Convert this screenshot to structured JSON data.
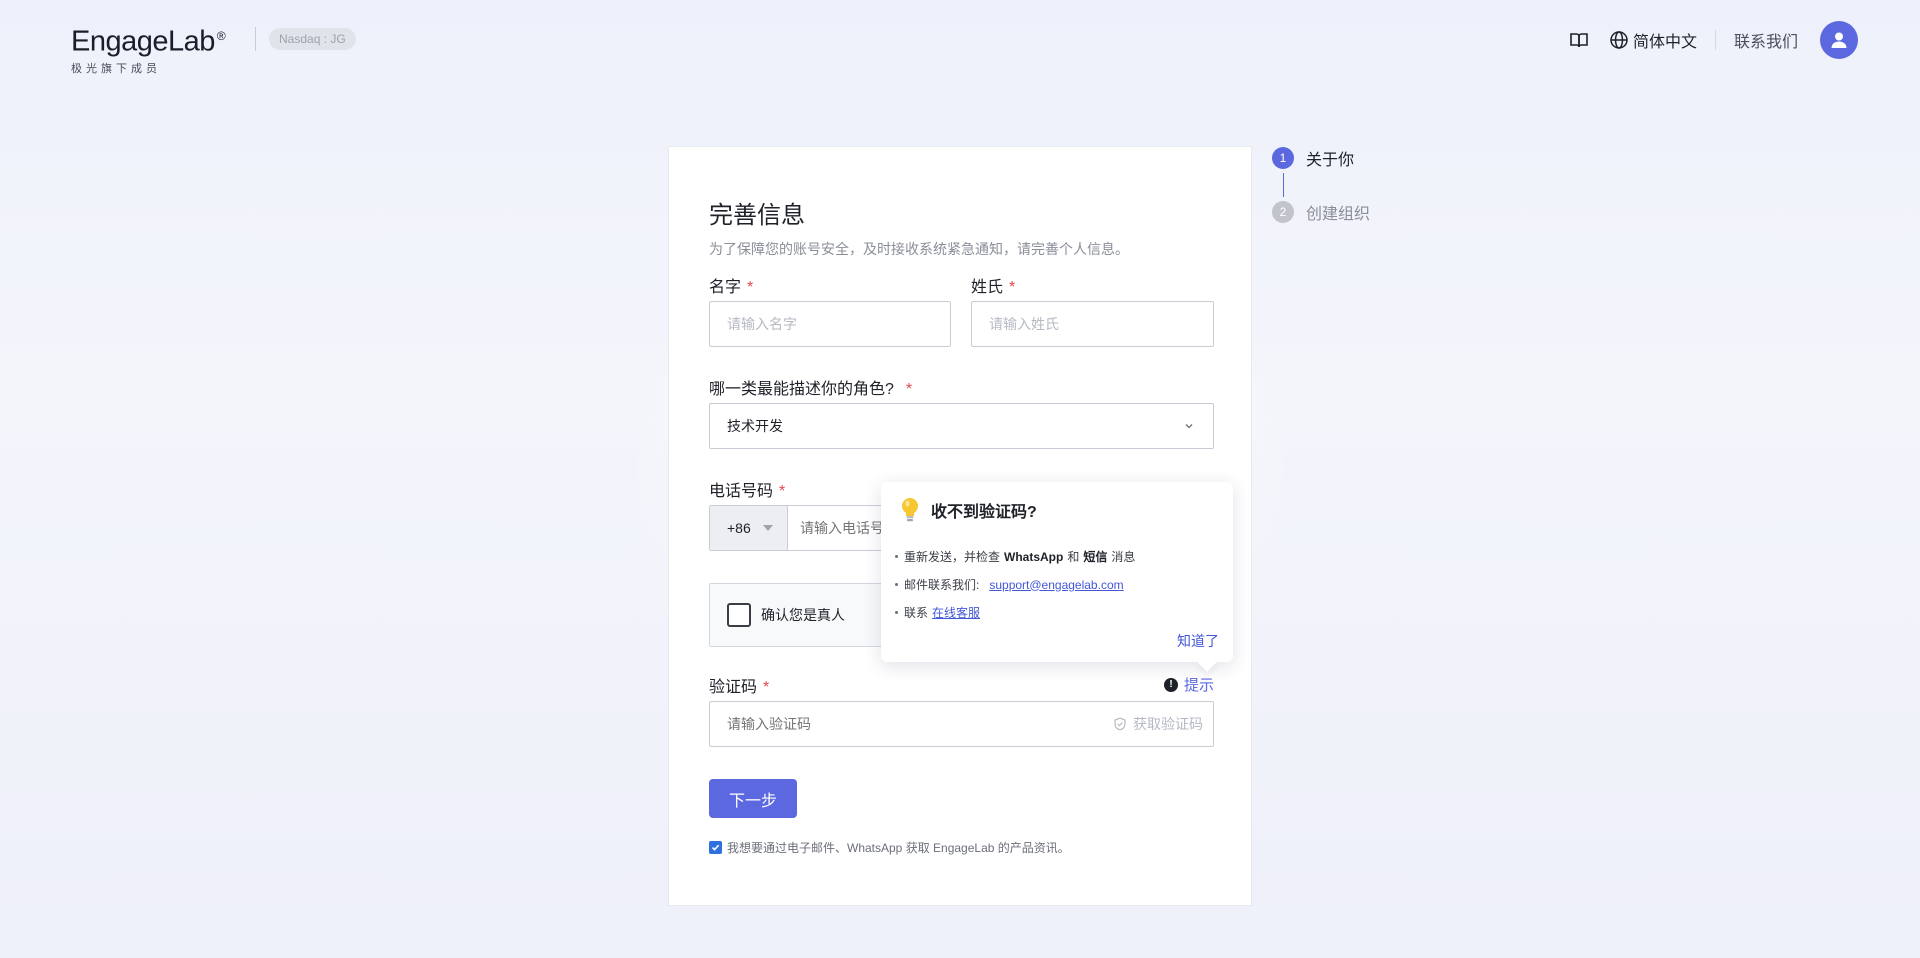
{
  "header": {
    "logo_text": "EngageLab",
    "logo_reg": "®",
    "logo_subtitle": "极光旗下成员",
    "nasdaq_badge": "Nasdaq : JG",
    "language": "简体中文",
    "contact_us": "联系我们",
    "icons": {
      "docs": "book-icon",
      "language": "globe-icon",
      "avatar": "user-icon"
    }
  },
  "form": {
    "title": "完善信息",
    "subtitle": "为了保障您的账号安全，及时接收系统紧急通知，请完善个人信息。",
    "required_mark": "*",
    "first_name": {
      "label": "名字",
      "placeholder": "请输入名字"
    },
    "last_name": {
      "label": "姓氏",
      "placeholder": "请输入姓氏"
    },
    "role": {
      "label": "哪一类最能描述你的角色?",
      "selected": "技术开发"
    },
    "phone": {
      "label": "电话号码",
      "country_code": "+86",
      "placeholder": "请输入电话号码"
    },
    "captcha": {
      "label": "确认您是真人"
    },
    "code": {
      "label": "验证码",
      "placeholder": "请输入验证码",
      "get_code": "获取验证码",
      "hint": "提示"
    },
    "next_button": "下一步",
    "consent": {
      "checked": true,
      "text": "我想要通过电子邮件、WhatsApp 获取 EngageLab 的产品资讯。"
    }
  },
  "popover": {
    "title": "收不到验证码?",
    "item1_prefix": "重新发送，并检查",
    "item1_whatsapp": "WhatsApp",
    "item1_and": "和",
    "item1_sms": "短信",
    "item1_suffix": "消息",
    "item2_prefix": "邮件联系我们:",
    "item2_email": "support@engagelab.com",
    "item3_prefix": "联系",
    "item3_link": "在线客服",
    "ok": "知道了"
  },
  "stepper": {
    "steps": [
      {
        "num": "1",
        "label": "关于你",
        "active": true
      },
      {
        "num": "2",
        "label": "创建组织",
        "active": false
      }
    ]
  },
  "colors": {
    "accent": "#5b68df",
    "required": "#e5484d",
    "link": "#4457d6"
  }
}
